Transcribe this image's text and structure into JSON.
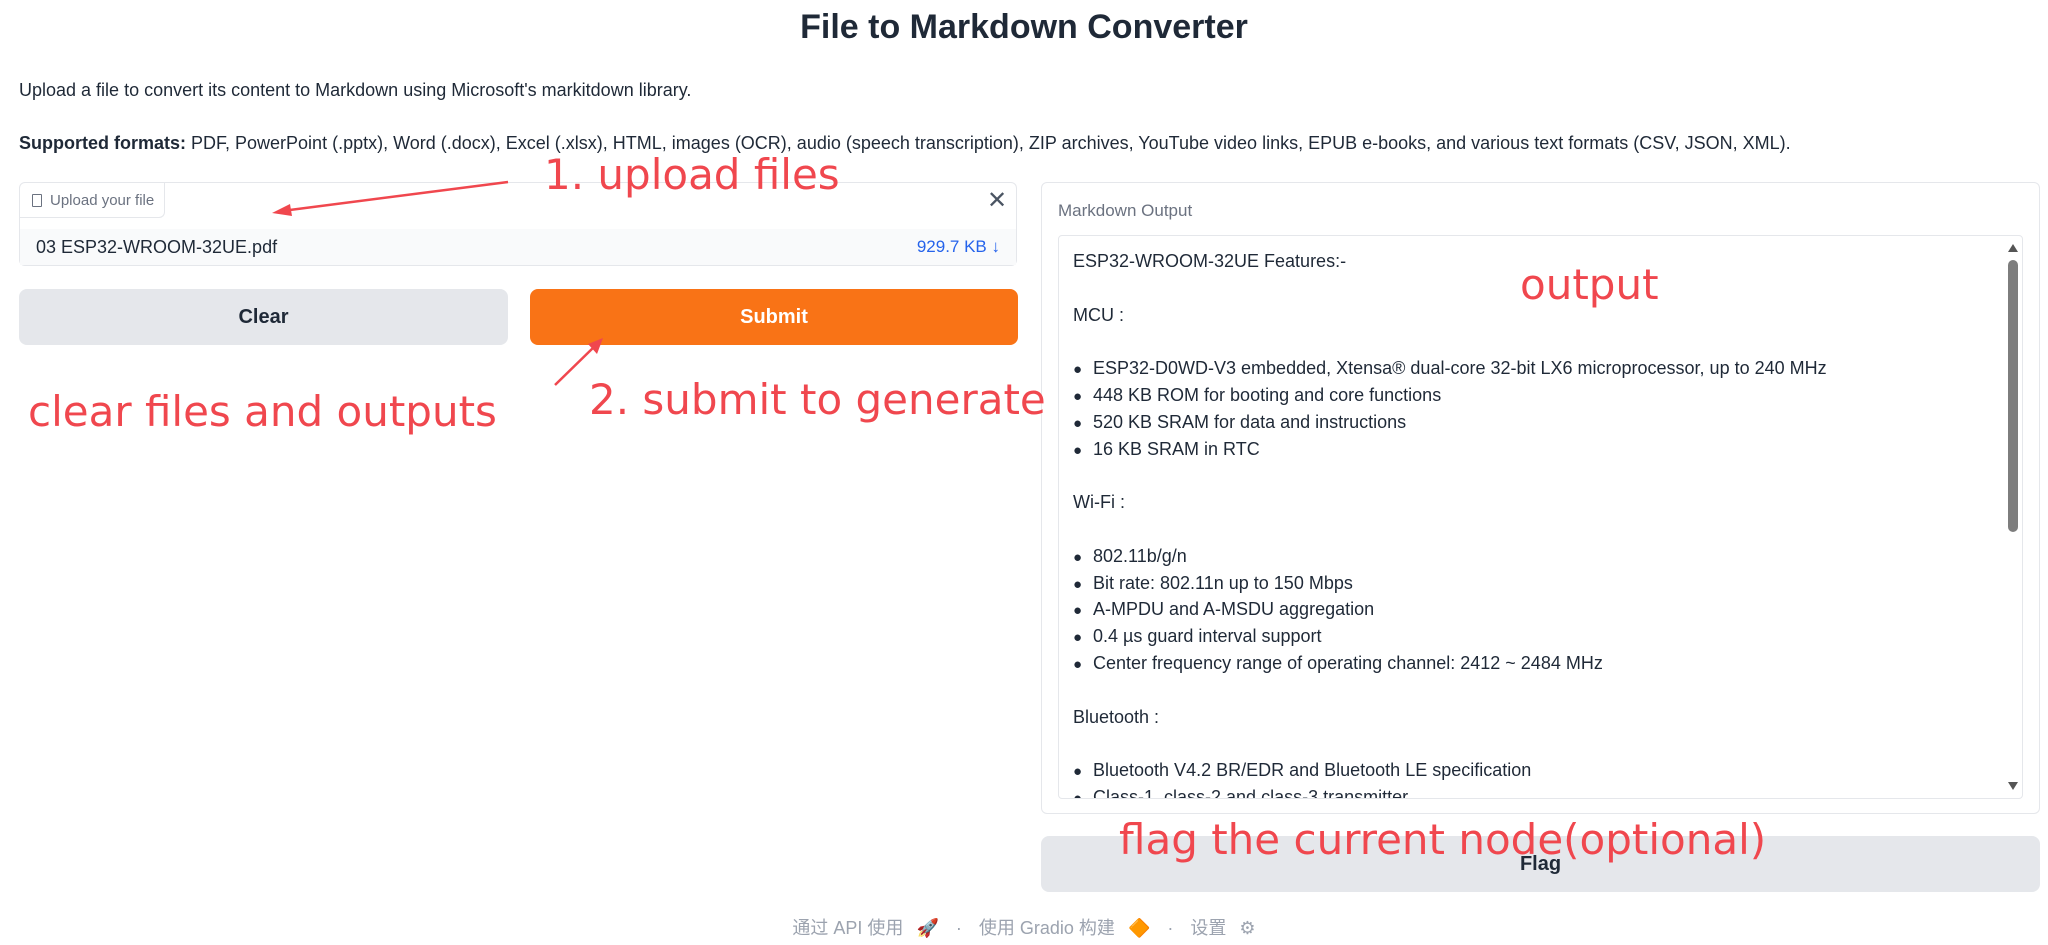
{
  "title": "File to Markdown Converter",
  "description": "Upload a file to convert its content to Markdown using Microsoft's markitdown library.",
  "formats_label": "Supported formats:",
  "formats_text": " PDF, PowerPoint (.pptx), Word (.docx), Excel (.xlsx), HTML, images (OCR), audio (speech transcription), ZIP archives, YouTube video links, EPUB e-books, and various text formats (CSV, JSON, XML).",
  "upload": {
    "label": "Upload your file",
    "close_glyph": "✕",
    "file_name": "03 ESP32-WROOM-32UE.pdf",
    "file_size": "929.7 KB ↓"
  },
  "buttons": {
    "clear": "Clear",
    "submit": "Submit",
    "flag": "Flag"
  },
  "output": {
    "label": "Markdown Output",
    "lines": [
      {
        "text": "ESP32-WROOM-32UE Features:-",
        "bullet": false
      },
      {
        "text": "",
        "bullet": false
      },
      {
        "text": "MCU :",
        "bullet": false
      },
      {
        "text": "",
        "bullet": false
      },
      {
        "text": "ESP32-D0WD-V3 embedded, Xtensa® dual-core 32-bit LX6 microprocessor, up to 240 MHz",
        "bullet": true
      },
      {
        "text": "448 KB ROM for booting and core functions",
        "bullet": true
      },
      {
        "text": "520 KB SRAM for data and instructions",
        "bullet": true
      },
      {
        "text": "16 KB SRAM in RTC",
        "bullet": true
      },
      {
        "text": "",
        "bullet": false
      },
      {
        "text": "Wi-Fi :",
        "bullet": false
      },
      {
        "text": "",
        "bullet": false
      },
      {
        "text": "802.11b/g/n",
        "bullet": true
      },
      {
        "text": "Bit rate: 802.11n up to 150 Mbps",
        "bullet": true
      },
      {
        "text": "A-MPDU and A-MSDU aggregation",
        "bullet": true
      },
      {
        "text": "0.4 µs guard interval support",
        "bullet": true
      },
      {
        "text": "Center frequency range of operating channel: 2412 ~ 2484 MHz",
        "bullet": true
      },
      {
        "text": "",
        "bullet": false
      },
      {
        "text": "Bluetooth :",
        "bullet": false
      },
      {
        "text": "",
        "bullet": false
      },
      {
        "text": "Bluetooth V4.2 BR/EDR and Bluetooth LE specification",
        "bullet": true
      },
      {
        "text": "Class-1, class-2 and class-3 transmitter",
        "bullet": true
      }
    ]
  },
  "annotations": {
    "upload": "1. upload files",
    "output": "output",
    "clear": "clear files and outputs",
    "submit": "2. submit to generate",
    "flag": "flag the current node(optional)"
  },
  "footer": {
    "api": "通过 API 使用",
    "api_icon": "🚀",
    "sep": "·",
    "built": "使用 Gradio 构建",
    "built_icon": "🔶",
    "settings": "设置",
    "settings_icon": "⚙"
  },
  "colors": {
    "accent": "#f97316",
    "annotation": "#f0474e",
    "link": "#2563eb"
  }
}
